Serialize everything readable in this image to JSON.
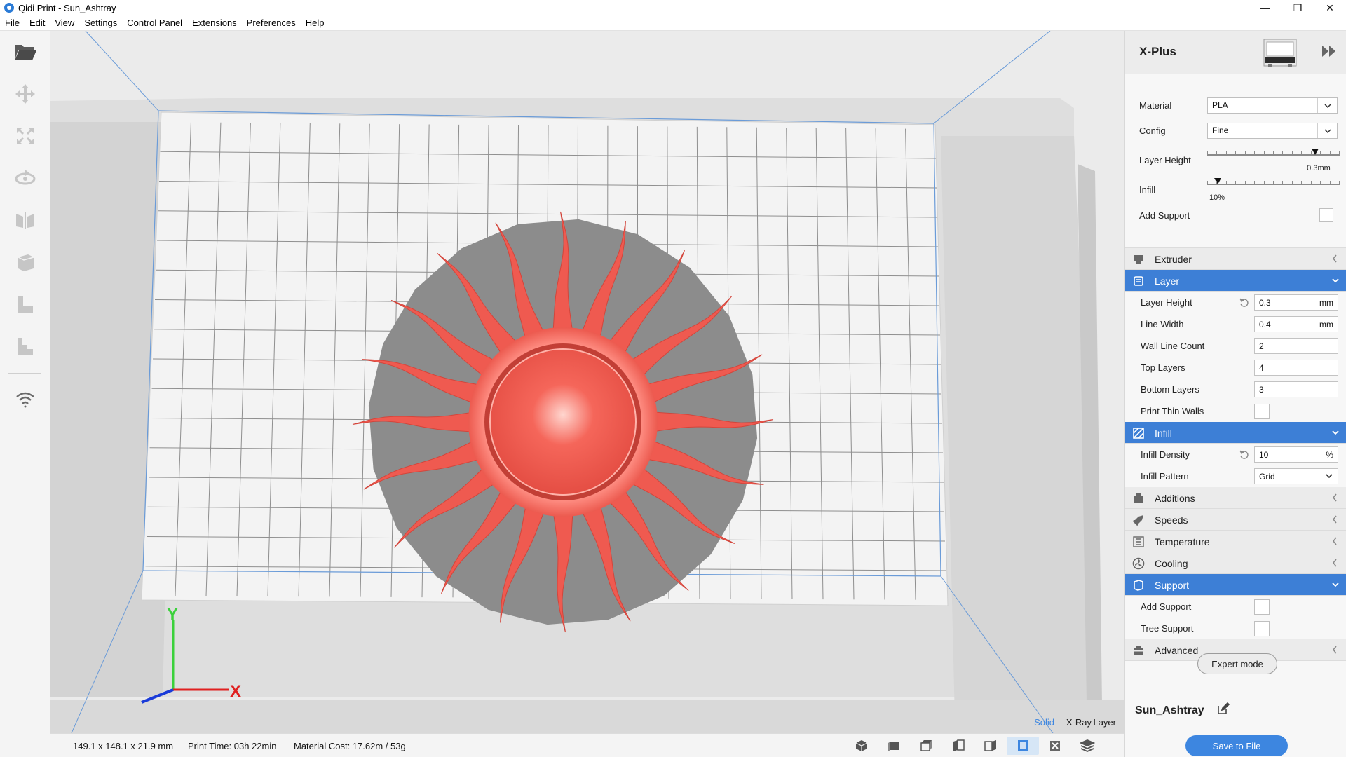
{
  "window": {
    "title": "Qidi Print - Sun_Ashtray",
    "controls": {
      "minimize": "—",
      "maximize": "❐",
      "close": "✕"
    }
  },
  "menu": [
    "File",
    "Edit",
    "View",
    "Settings",
    "Control Panel",
    "Extensions",
    "Preferences",
    "Help"
  ],
  "left_toolbar": {
    "tools": [
      "open-folder-icon",
      "move-icon",
      "scale-icon",
      "rotate-icon",
      "mirror-icon",
      "per-model-settings-icon",
      "support-blocker-icon",
      "lay-flat-icon",
      "wifi-icon"
    ]
  },
  "viewport": {
    "view_modes": [
      "Solid",
      "X-Ray",
      "Layer"
    ],
    "active_view_mode": "Solid",
    "axis_labels": {
      "x": "X",
      "y": "Y"
    },
    "colors": {
      "model": "#ef5a50",
      "plate": "#8c8c8c",
      "bed": "#f3f3f3",
      "grid": "#8f8f8f",
      "accent": "#3d86e0"
    }
  },
  "status": {
    "dimensions": "149.1 x 148.1 x 21.9 mm",
    "print_time": "Print Time: 03h 22min",
    "material_cost": "Material Cost: 17.62m / 53g",
    "view_buttons": [
      "3d-view-icon",
      "front-view-icon",
      "top-view-icon",
      "left-view-icon",
      "right-view-icon",
      "solid-view-icon",
      "xray-view-icon",
      "layer-view-icon"
    ]
  },
  "panel": {
    "printer": "X-Plus",
    "quick": {
      "material_label": "Material",
      "material_value": "PLA",
      "config_label": "Config",
      "config_value": "Fine",
      "layer_height_label": "Layer Height",
      "layer_height_value": "0.3mm",
      "layer_height_fraction": 0.82,
      "infill_label": "Infill",
      "infill_value": "10%",
      "infill_fraction": 0.08,
      "add_support_label": "Add Support"
    },
    "sections": [
      {
        "label": "Extruder",
        "icon": "extruder-icon",
        "expanded": false
      },
      {
        "label": "Layer",
        "icon": "layer-icon",
        "expanded": true,
        "rows": [
          {
            "label": "Layer Height",
            "value": "0.3",
            "unit": "mm",
            "type": "input",
            "reset": true
          },
          {
            "label": "Line Width",
            "value": "0.4",
            "unit": "mm",
            "type": "input"
          },
          {
            "label": "Wall Line Count",
            "value": "2",
            "type": "input"
          },
          {
            "label": "Top Layers",
            "value": "4",
            "type": "input"
          },
          {
            "label": "Bottom Layers",
            "value": "3",
            "type": "input"
          },
          {
            "label": "Print Thin Walls",
            "type": "check"
          }
        ]
      },
      {
        "label": "Infill",
        "icon": "infill-icon",
        "expanded": true,
        "rows": [
          {
            "label": "Infill Density",
            "value": "10",
            "unit": "%",
            "type": "input",
            "reset": true
          },
          {
            "label": "Infill Pattern",
            "value": "Grid",
            "type": "select"
          }
        ]
      },
      {
        "label": "Additions",
        "icon": "additions-icon",
        "expanded": false
      },
      {
        "label": "Speeds",
        "icon": "speeds-icon",
        "expanded": false
      },
      {
        "label": "Temperature",
        "icon": "temperature-icon",
        "expanded": false
      },
      {
        "label": "Cooling",
        "icon": "cooling-icon",
        "expanded": false
      },
      {
        "label": "Support",
        "icon": "support-icon",
        "expanded": true,
        "rows": [
          {
            "label": "Add Support",
            "type": "check"
          },
          {
            "label": "Tree Support",
            "type": "check"
          }
        ]
      },
      {
        "label": "Advanced",
        "icon": "advanced-icon",
        "expanded": false
      }
    ],
    "expert_mode": "Expert mode",
    "job_name": "Sun_Ashtray",
    "save_button": "Save to File"
  }
}
